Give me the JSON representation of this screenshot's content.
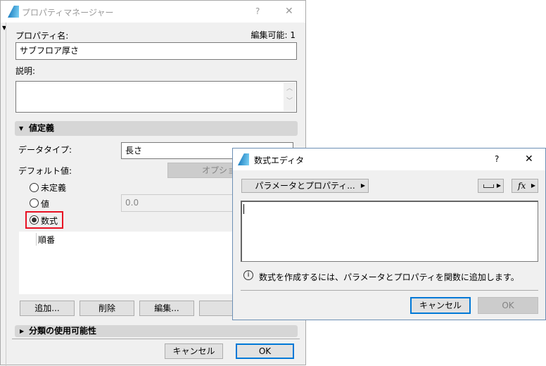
{
  "main_dialog": {
    "title": "プロパティマネージャー",
    "help": "?",
    "close": "✕",
    "property_name_label": "プロパティ名:",
    "editable_count": "編集可能: 1",
    "property_name_value": "サブフロア厚さ",
    "description_label": "説明:",
    "description_value": "",
    "section_value_definition": "値定義",
    "data_type_label": "データタイプ:",
    "data_type_value": "長さ",
    "default_value_label": "デフォルト値:",
    "options_button": "オプション",
    "radio_undefined": "未定義",
    "radio_value": "値",
    "radio_formula": "数式",
    "value_field": "0.0",
    "list_header": "順番",
    "add_button": "追加...",
    "delete_button": "削除",
    "edit_button": "編集...",
    "section_classification": "分類の使用可能性",
    "cancel_button": "キャンセル",
    "ok_button": "OK"
  },
  "formula_editor": {
    "title": "数式エディタ",
    "help": "?",
    "close": "✕",
    "params_button": "パラメータとプロパティ...",
    "fx_label": "fx",
    "formula_value": "",
    "info_text": "数式を作成するには、パラメータとプロパティを関数に追加します。",
    "cancel_button": "キャンセル",
    "ok_button": "OK"
  },
  "colors": {
    "accent": "#0078d7",
    "highlight": "#e81123"
  }
}
